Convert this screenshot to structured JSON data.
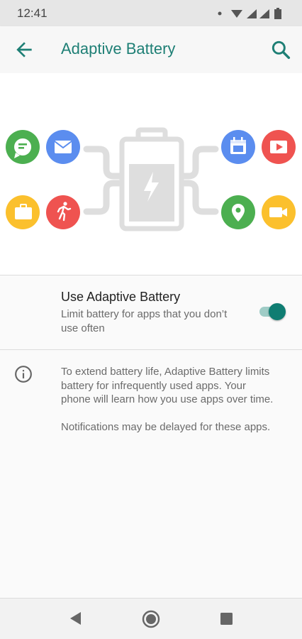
{
  "status_bar": {
    "time": "12:41"
  },
  "app_bar": {
    "title": "Adaptive Battery"
  },
  "setting": {
    "title": "Use Adaptive Battery",
    "subtitle": "Limit battery for apps that you don’t use often",
    "toggle_on": true
  },
  "info": {
    "paragraph1": "To extend battery life, Adaptive Battery limits battery for infrequently used apps. Your phone will learn how you use apps over time.",
    "paragraph2": "Notifications may be delayed for these apps."
  },
  "icons": {
    "status": [
      "dot-icon",
      "wifi-icon",
      "signal-icon",
      "signal-icon",
      "battery-icon"
    ],
    "hero_left": [
      "chat-icon",
      "mail-icon",
      "briefcase-icon",
      "run-icon"
    ],
    "hero_right": [
      "calendar-icon",
      "video-icon",
      "map-pin-icon",
      "camera-icon"
    ],
    "hero_center": "battery-charging-icon"
  },
  "colors": {
    "accent": "#1e7f75",
    "toggle_thumb": "#0f7d72",
    "toggle_track": "#9fccc6",
    "green": "#4caf50",
    "blue": "#5b8def",
    "yellow": "#fbc02d",
    "red": "#ef5350"
  }
}
